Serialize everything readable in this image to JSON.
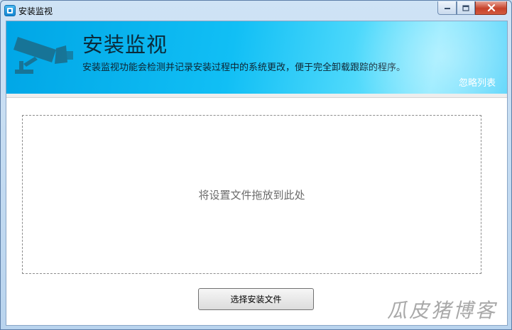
{
  "window": {
    "title": "安装监视"
  },
  "titlebar": {
    "icons": [
      "app-icon",
      "minimize-icon",
      "maximize-icon",
      "close-icon"
    ]
  },
  "banner": {
    "title": "安装监视",
    "description": "安装监视功能会检测并记录安装过程中的系统更改，便于完全卸载跟踪的程序。",
    "ignore_list_link": "忽略列表",
    "icon": "security-camera-icon"
  },
  "dropzone": {
    "hint": "将设置文件拖放到此处"
  },
  "actions": {
    "select_install_file": "选择安装文件"
  },
  "watermark": {
    "text": "瓜皮猪博客"
  },
  "colors": {
    "banner_accent": "#11bff5",
    "close_button": "#c7422a"
  }
}
